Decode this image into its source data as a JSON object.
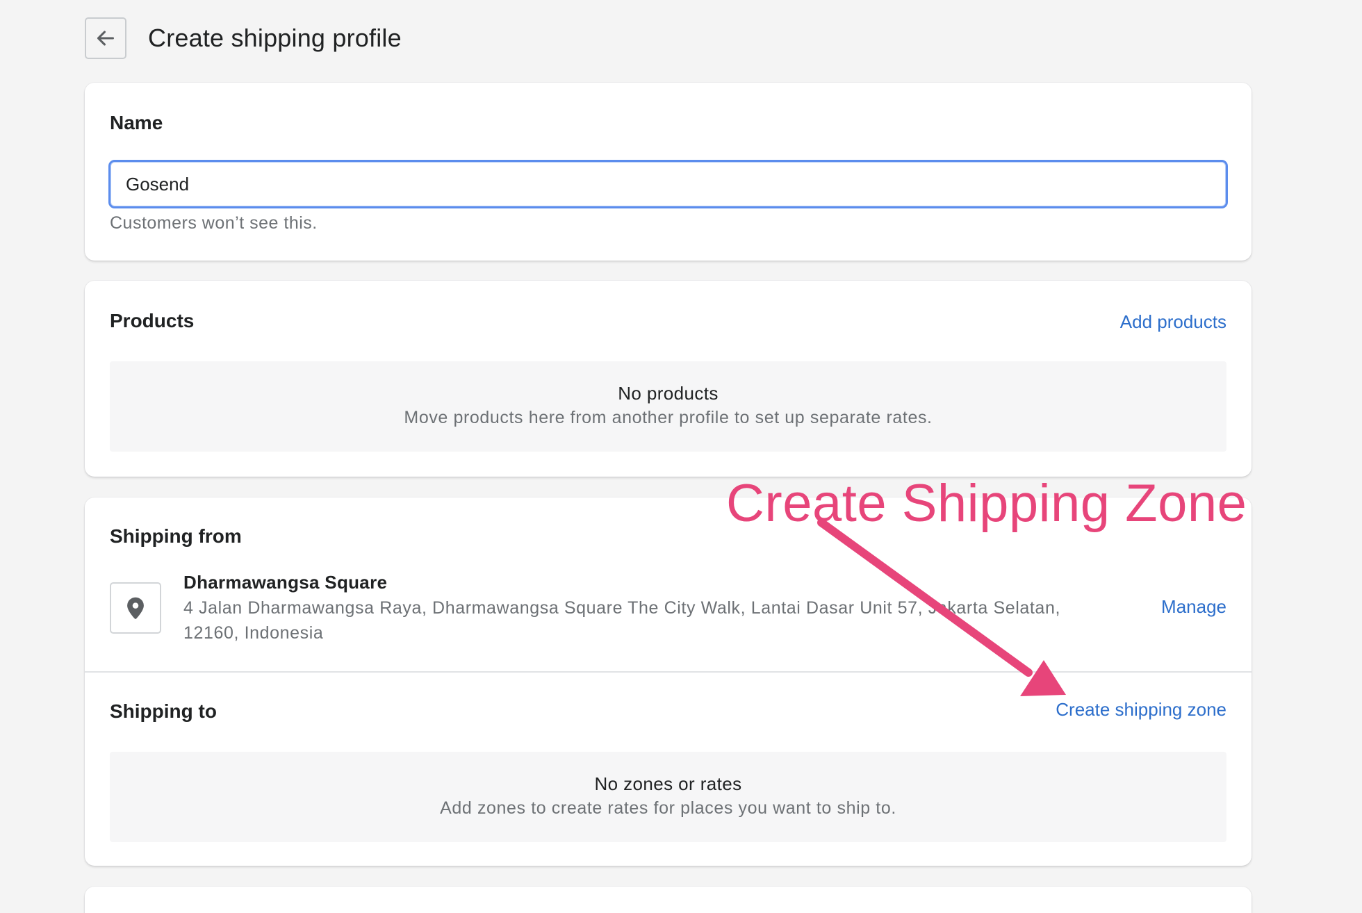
{
  "header": {
    "back_label": "Back",
    "title": "Create shipping profile"
  },
  "name_section": {
    "heading": "Name",
    "input_value": "Gosend",
    "help_text": "Customers won’t see this."
  },
  "products_section": {
    "heading": "Products",
    "action": "Add products",
    "empty_title": "No products",
    "empty_text": "Move products here from another profile to set up separate rates."
  },
  "shipping_from": {
    "heading": "Shipping from",
    "location_name": "Dharmawangsa Square",
    "location_address": "4 Jalan Dharmawangsa Raya, Dharmawangsa Square The City Walk, Lantai Dasar Unit 57, Jakarta Selatan, 12160, Indonesia",
    "action": "Manage",
    "icon": "location-pin-icon"
  },
  "shipping_to": {
    "heading": "Shipping to",
    "action": "Create shipping zone",
    "empty_title": "No zones or rates",
    "empty_text": "Add zones to create rates for places you want to ship to."
  },
  "annotation": {
    "text": "Create Shipping Zone",
    "color": "#e7457a"
  },
  "colors": {
    "link": "#2c6ecb",
    "focus_border": "#5c8ded",
    "background": "#f4f4f4"
  }
}
